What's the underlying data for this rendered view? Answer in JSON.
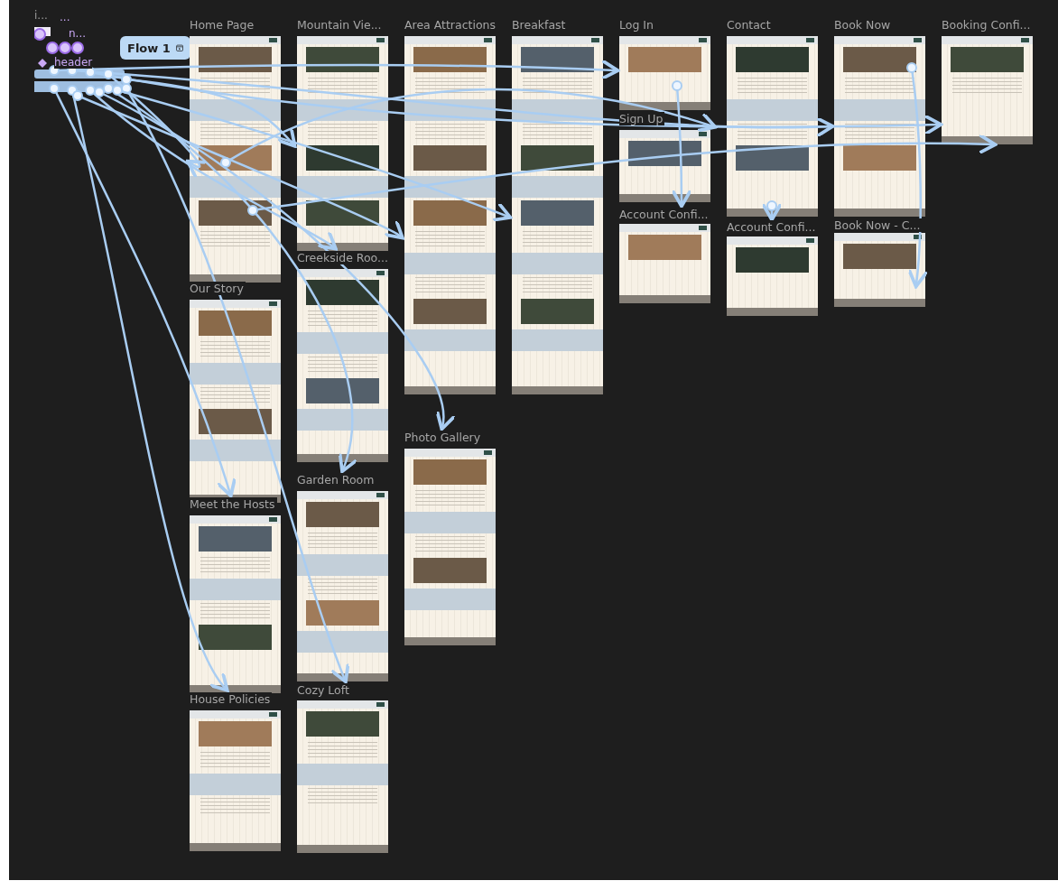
{
  "layers": [
    {
      "label": "i...",
      "kind": "plain"
    },
    {
      "label": "...",
      "kind": "component"
    },
    {
      "label": "n...",
      "kind": "component"
    },
    {
      "label": "header",
      "kind": "component"
    }
  ],
  "flow": {
    "label": "Flow 1"
  },
  "frames": [
    {
      "title": "Home Page"
    },
    {
      "title": "Mountain Vie..."
    },
    {
      "title": "Area Attractions"
    },
    {
      "title": "Breakfast"
    },
    {
      "title": "Log In"
    },
    {
      "title": "Contact"
    },
    {
      "title": "Book Now"
    },
    {
      "title": "Booking Confi..."
    },
    {
      "title": "Our Story"
    },
    {
      "title": "Meet the Hosts"
    },
    {
      "title": "House Policies"
    },
    {
      "title": "Creekside Roo..."
    },
    {
      "title": "Garden Room"
    },
    {
      "title": "Cozy Loft"
    },
    {
      "title": "Photo Gallery"
    },
    {
      "title": "Sign Up"
    },
    {
      "title": "Account Confi..."
    },
    {
      "title": "Account Confi..."
    },
    {
      "title": "Book Now - C..."
    }
  ]
}
